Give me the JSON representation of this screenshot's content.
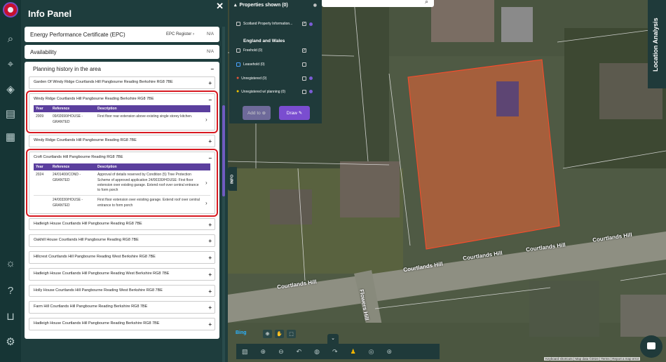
{
  "panel": {
    "title": "Info Panel",
    "close": "✕",
    "rows": [
      {
        "label": "Energy Performance Certificate (EPC)",
        "link": "EPC Register",
        "value": "N/A"
      },
      {
        "label": "Availability",
        "value": "N/A"
      }
    ],
    "planning": {
      "title": "Planning history in the area",
      "toggle": "−",
      "columns": [
        "Year",
        "Reference",
        "Description"
      ],
      "items": [
        {
          "address": "Garden Of Windy Ridge Courtlands Hill Pangbourne Reading Berkshire RG8 7BE",
          "toggle": "+"
        },
        {
          "address": "Windy Ridge Courtlands Hill Pangbourne Reading Berkshire RG8 7BE",
          "toggle": "−",
          "rows": [
            {
              "year": "2009",
              "reference": "09/02690/HOUSE - GRANTED",
              "description": "First floor rear extension above existing single storey kitchen."
            }
          ]
        },
        {
          "address": "Windy Ridge Courtlands Hill Pangbourne Reading RG8 7BE",
          "toggle": "+"
        },
        {
          "address": "Croft Courtlands Hill Pangbourne Reading RG8 7BE",
          "toggle": "−",
          "rows": [
            {
              "year": "2024",
              "reference": "24/01400/COND - GRANTED",
              "description": "Approval of details reserved by Condition (5) Tree Protection Scheme of approved application 24/00330/HOUSE: First floor extension over existing garage. Extend roof over central entrance to form porch"
            },
            {
              "year": "",
              "reference": "24/00330/HOUSE - GRANTED",
              "description": "First floor extension over existing garage. Extend roof over central entrance to form porch"
            }
          ]
        },
        {
          "address": "Hadleigh House Courtlands Hill Pangbourne Reading RG8 7BE",
          "toggle": "+"
        },
        {
          "address": "Oakhill House Courtlands Hill Pangbourne Reading RG8 7BE",
          "toggle": "+"
        },
        {
          "address": "Hillcrest Courtlands Hill Pangbourne Reading West Berkshire RG8 7BE",
          "toggle": "+"
        },
        {
          "address": "Hadleigh House Courtlands Hill Pangbourne Reading West Berkshire RG8 7BE",
          "toggle": "+"
        },
        {
          "address": "Holly House Courtlands Hill Pangbourne Reading West Berkshire RG8 7BE",
          "toggle": "+"
        },
        {
          "address": "Farm Hill Courtlands Hill Pangbourne Reading Berkshire RG8 7BE",
          "toggle": "+"
        },
        {
          "address": "Hadleigh House Courtlands Hill Pangbourne Reading Berkshire RG8 7BE",
          "toggle": "+"
        }
      ]
    }
  },
  "properties": {
    "title": "Properties shown (0)",
    "scotland": "Scotland Property Information...",
    "section": "England and Wales",
    "options": [
      "Freehold (0)",
      "Leasehold (0)",
      "Unregistered (0)",
      "Unregistered w/ planning (0)"
    ],
    "add_label": "Add to",
    "draw_label": "Draw"
  },
  "map": {
    "info_tab": "INFO",
    "location_analysis": "Location Analysis",
    "roads": [
      "Courtlands Hill",
      "Courtlands Hill",
      "Courtlands Hill",
      "Courtlands Hill",
      "Courtlands Hill",
      "Flowers Hill"
    ],
    "bing": "Bing",
    "attribution": "Keyboard shortcuts | Map data ©2024 | Terms | Report a map error"
  },
  "colors": {
    "accent": "#7a4dd0",
    "highlight": "#d71920",
    "panel_bg": "#1e3d3d"
  }
}
